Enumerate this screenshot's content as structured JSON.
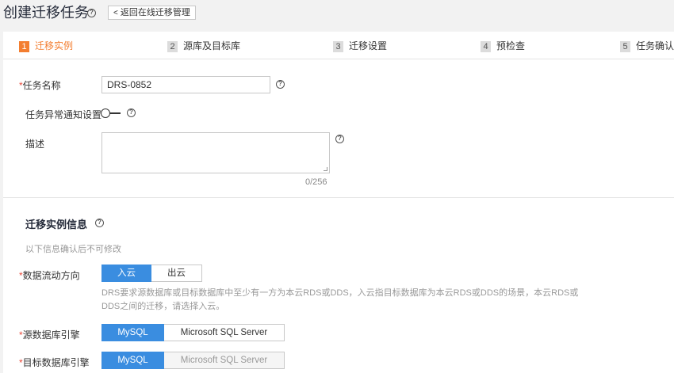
{
  "header": {
    "title": "创建迁移任务",
    "back_label": "返回在线迁移管理"
  },
  "steps": [
    {
      "num": "1",
      "label": "迁移实例"
    },
    {
      "num": "2",
      "label": "源库及目标库"
    },
    {
      "num": "3",
      "label": "迁移设置"
    },
    {
      "num": "4",
      "label": "预检查"
    },
    {
      "num": "5",
      "label": "任务确认"
    }
  ],
  "form": {
    "task_name_label": "任务名称",
    "task_name_value": "DRS-0852",
    "notify_label": "任务异常通知设置",
    "notify_enabled": false,
    "desc_label": "描述",
    "desc_value": "",
    "desc_counter": "0/256",
    "required_mark": "*"
  },
  "instance_info": {
    "title": "迁移实例信息",
    "hint": "以下信息确认后不可修改",
    "direction_label": "数据流动方向",
    "direction_options": [
      "入云",
      "出云"
    ],
    "direction_selected": "入云",
    "direction_desc": "DRS要求源数据库或目标数据库中至少有一方为本云RDS或DDS，入云指目标数据库为本云RDS或DDS的场景，本云RDS或DDS之间的迁移，请选择入云。",
    "source_label": "源数据库引擎",
    "source_options": [
      "MySQL",
      "Microsoft SQL Server"
    ],
    "source_selected": "MySQL",
    "target_label": "目标数据库引擎",
    "target_options": [
      "MySQL",
      "Microsoft SQL Server"
    ],
    "target_selected": "MySQL"
  },
  "colors": {
    "accent_orange": "#f37e30",
    "selected_blue": "#3a8de0",
    "required_red": "#e84a3b"
  },
  "icons": [
    "help-icon",
    "chevron-left-icon",
    "toggle-switch",
    "resize-handle-icon"
  ]
}
